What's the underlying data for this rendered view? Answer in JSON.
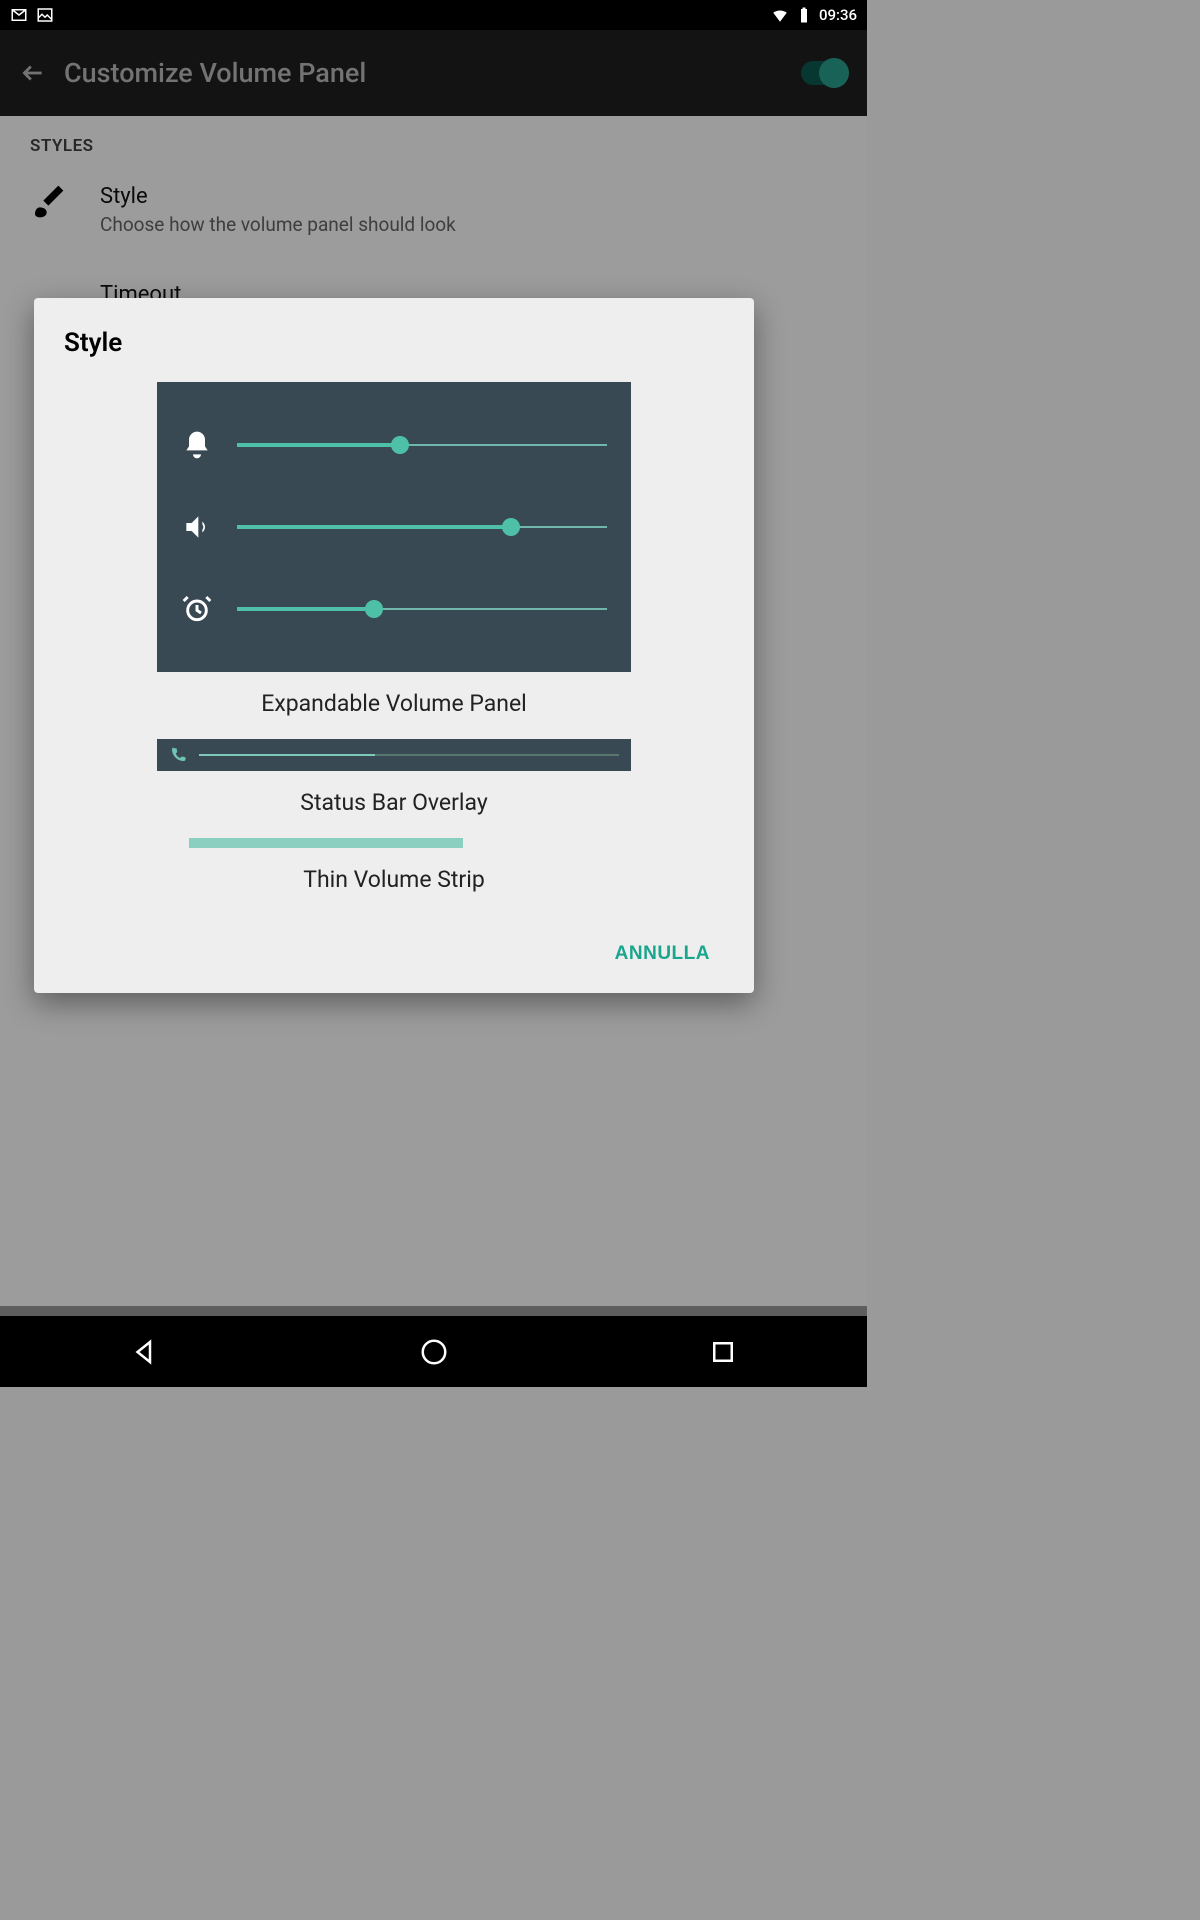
{
  "status_bar": {
    "time": "09:36"
  },
  "app_bar": {
    "title": "Customize Volume Panel",
    "switch_on": true
  },
  "background": {
    "section_title": "STYLES",
    "item_style": {
      "title": "Style",
      "subtitle": "Choose how the volume panel should look"
    },
    "item_timeout_title": "Timeout"
  },
  "dialog": {
    "title": "Style",
    "options": {
      "expandable": "Expandable Volume Panel",
      "statusbar": "Status Bar Overlay",
      "thinstrip": "Thin Volume Strip"
    },
    "sliders": {
      "bell_pct": 44,
      "speaker_pct": 74,
      "alarm_pct": 37,
      "statusbar_pct": 42
    },
    "cancel_label": "ANNULLA"
  },
  "colors": {
    "accent": "#4fc0a8",
    "panel_bg": "#394954"
  }
}
